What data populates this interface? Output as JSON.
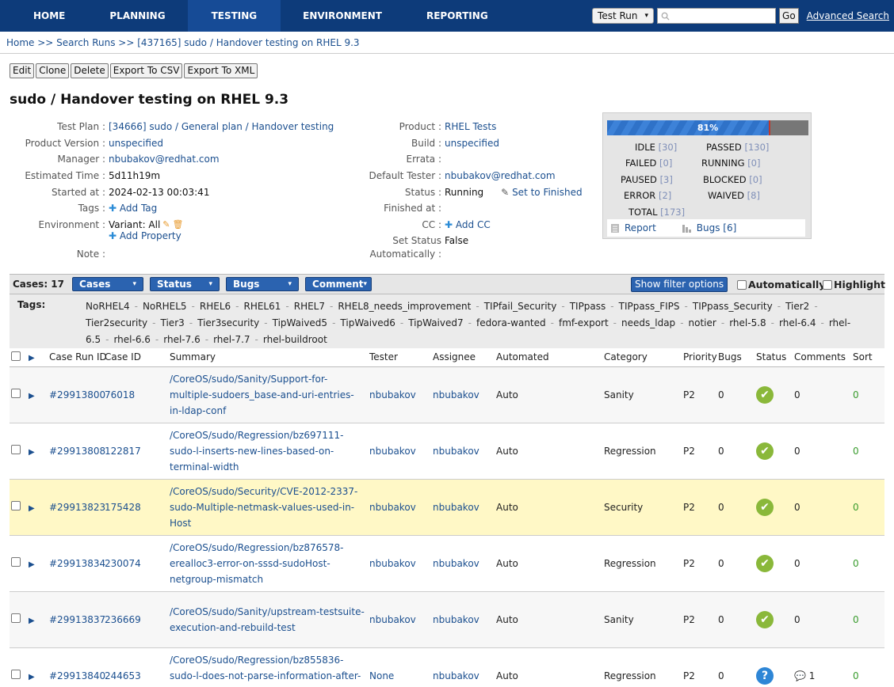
{
  "nav": {
    "items": [
      "HOME",
      "PLANNING",
      "TESTING",
      "ENVIRONMENT",
      "REPORTING"
    ],
    "active": "TESTING",
    "search_select": "Test Run",
    "go_label": "Go",
    "advanced_search": "Advanced Search"
  },
  "breadcrumb": "Home >> Search Runs >> [437165] sudo / Handover testing on RHEL 9.3",
  "actions": [
    "Edit",
    "Clone",
    "Delete",
    "Export To CSV",
    "Export To XML"
  ],
  "title": "sudo / Handover testing on RHEL 9.3",
  "info_left": {
    "test_plan_label": "Test Plan :",
    "test_plan": "[34666] sudo / General plan / Handover testing",
    "product_version_label": "Product Version :",
    "product_version": "unspecified",
    "manager_label": "Manager :",
    "manager": "nbubakov@redhat.com",
    "estimated_label": "Estimated Time :",
    "estimated": "5d11h19m",
    "started_label": "Started at :",
    "started": "2024-02-13 00:03:41",
    "tags_label": "Tags :",
    "add_tag": "Add Tag",
    "environment_label": "Environment :",
    "environment": "Variant: All",
    "add_property": "Add Property",
    "note_label": "Note :"
  },
  "info_right": {
    "product_label": "Product :",
    "product": "RHEL Tests",
    "build_label": "Build :",
    "build": "unspecified",
    "errata_label": "Errata :",
    "default_tester_label": "Default Tester :",
    "default_tester": "nbubakov@redhat.com",
    "status_label": "Status :",
    "status": "Running",
    "set_finished": "Set to Finished",
    "finished_label": "Finished at :",
    "cc_label": "CC :",
    "add_cc": "Add CC",
    "set_status_label": "Set Status",
    "set_status": "False",
    "automatically_label": "Automatically :"
  },
  "progress": {
    "percent_text": "81%",
    "fraction": 0.81,
    "stats": {
      "idle": [
        "IDLE",
        "[30]"
      ],
      "passed": [
        "PASSED",
        "[130]"
      ],
      "failed": [
        "FAILED",
        "[0]"
      ],
      "running": [
        "RUNNING",
        "[0]"
      ],
      "paused": [
        "PAUSED",
        "[3]"
      ],
      "blocked": [
        "BLOCKED",
        "[0]"
      ],
      "error": [
        "ERROR",
        "[2]"
      ],
      "waived": [
        "WAIVED",
        "[8]"
      ],
      "total": [
        "TOTAL",
        "[173]"
      ]
    },
    "report": "Report",
    "bugs": "Bugs [6]"
  },
  "filter": {
    "cases_count": "Cases: 17",
    "dropdowns": [
      "Cases",
      "Status",
      "Bugs",
      "Comment"
    ],
    "show_filter": "Show filter options",
    "automatically": "Automatically",
    "highlight": "Highlight"
  },
  "tags": {
    "title": "Tags:",
    "items": [
      "NoRHEL4",
      "NoRHEL5",
      "RHEL6",
      "RHEL61",
      "RHEL7",
      "RHEL8_needs_improvement",
      "TIPfail_Security",
      "TIPpass",
      "TIPpass_FIPS",
      "TIPpass_Security",
      "Tier2",
      "Tier2security",
      "Tier3",
      "Tier3security",
      "TipWaived5",
      "TipWaived6",
      "TipWaived7",
      "fedora-wanted",
      "fmf-export",
      "needs_ldap",
      "notier",
      "rhel-5.8",
      "rhel-6.4",
      "rhel-6.5",
      "rhel-6.6",
      "rhel-7.6",
      "rhel-7.7",
      "rhel-buildroot"
    ]
  },
  "table": {
    "headers": [
      "Case Run ID",
      "Case ID",
      "Summary",
      "Tester",
      "Assignee",
      "Automated",
      "Category",
      "Priority",
      "Bugs",
      "Status",
      "Comments",
      "Sort"
    ],
    "rows": [
      {
        "run": "#29913800",
        "case": "76018",
        "summary": "/CoreOS/sudo/Sanity/Support-for-multiple-sudoers_base-and-uri-entries-in-ldap-conf",
        "tester": "nbubakov",
        "assignee": "nbubakov",
        "automated": "Auto",
        "category": "Sanity",
        "priority": "P2",
        "bugs": "0",
        "status": "passed",
        "comments": "0",
        "sort": "0"
      },
      {
        "run": "#29913808",
        "case": "122817",
        "summary": "/CoreOS/sudo/Regression/bz697111-sudo-l-inserts-new-lines-based-on-terminal-width",
        "tester": "nbubakov",
        "assignee": "nbubakov",
        "automated": "Auto",
        "category": "Regression",
        "priority": "P2",
        "bugs": "0",
        "status": "passed",
        "comments": "0",
        "sort": "0"
      },
      {
        "run": "#29913823",
        "case": "175428",
        "summary": "/CoreOS/sudo/Security/CVE-2012-2337-sudo-Multiple-netmask-values-used-in-Host",
        "tester": "nbubakov",
        "assignee": "nbubakov",
        "automated": "Auto",
        "category": "Security",
        "priority": "P2",
        "bugs": "0",
        "status": "passed",
        "comments": "0",
        "sort": "0"
      },
      {
        "run": "#29913834",
        "case": "230074",
        "summary": "/CoreOS/sudo/Regression/bz876578-erealloc3-error-on-sssd-sudoHost-netgroup-mismatch",
        "tester": "nbubakov",
        "assignee": "nbubakov",
        "automated": "Auto",
        "category": "Regression",
        "priority": "P2",
        "bugs": "0",
        "status": "passed",
        "comments": "0",
        "sort": "0"
      },
      {
        "run": "#29913837",
        "case": "236669",
        "summary": "/CoreOS/sudo/Sanity/upstream-testsuite-execution-and-rebuild-test",
        "tester": "nbubakov",
        "assignee": "nbubakov",
        "automated": "Auto",
        "category": "Sanity",
        "priority": "P2",
        "bugs": "0",
        "status": "passed",
        "comments": "0",
        "sort": "0"
      },
      {
        "run": "#29913840",
        "case": "244653",
        "summary": "/CoreOS/sudo/Regression/bz855836-sudo-l-does-not-parse-information-after-the",
        "tester": "None",
        "assignee": "nbubakov",
        "automated": "Auto",
        "category": "Regression",
        "priority": "P2",
        "bugs": "0",
        "status": "idle",
        "comments": "1",
        "sort": "0"
      }
    ]
  }
}
